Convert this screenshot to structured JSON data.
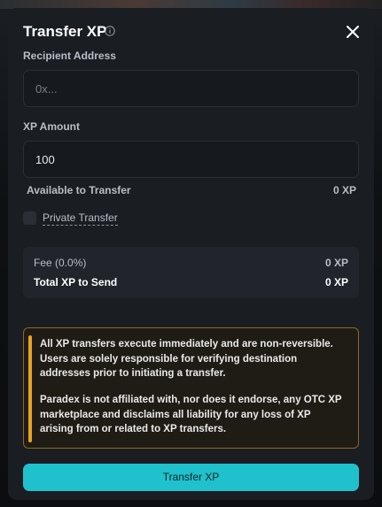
{
  "modal": {
    "title": "Transfer XP",
    "info_icon": "info-icon",
    "close_icon": "close-icon"
  },
  "recipient": {
    "label": "Recipient Address",
    "placeholder": "0x...",
    "value": ""
  },
  "amount": {
    "label": "XP Amount",
    "value": "100"
  },
  "available": {
    "label": "Available to Transfer",
    "value": "0 XP"
  },
  "private_transfer": {
    "label": "Private Transfer",
    "checked": false
  },
  "fees": {
    "fee_label": "Fee (0.0%)",
    "fee_value": "0 XP",
    "total_label": "Total XP to Send",
    "total_value": "0 XP"
  },
  "warning": {
    "paragraph1": "All XP transfers execute immediately and are non-reversible. Users are solely responsible for verifying destination addresses prior to initiating a transfer.",
    "paragraph2": "Paradex is not affiliated with, nor does it endorse, any OTC XP marketplace and disclaims all liability for any loss of XP arising from or related to XP transfers.",
    "accent_color": "#e9a321"
  },
  "submit": {
    "label": "Transfer XP",
    "color": "#1fc1cc"
  }
}
